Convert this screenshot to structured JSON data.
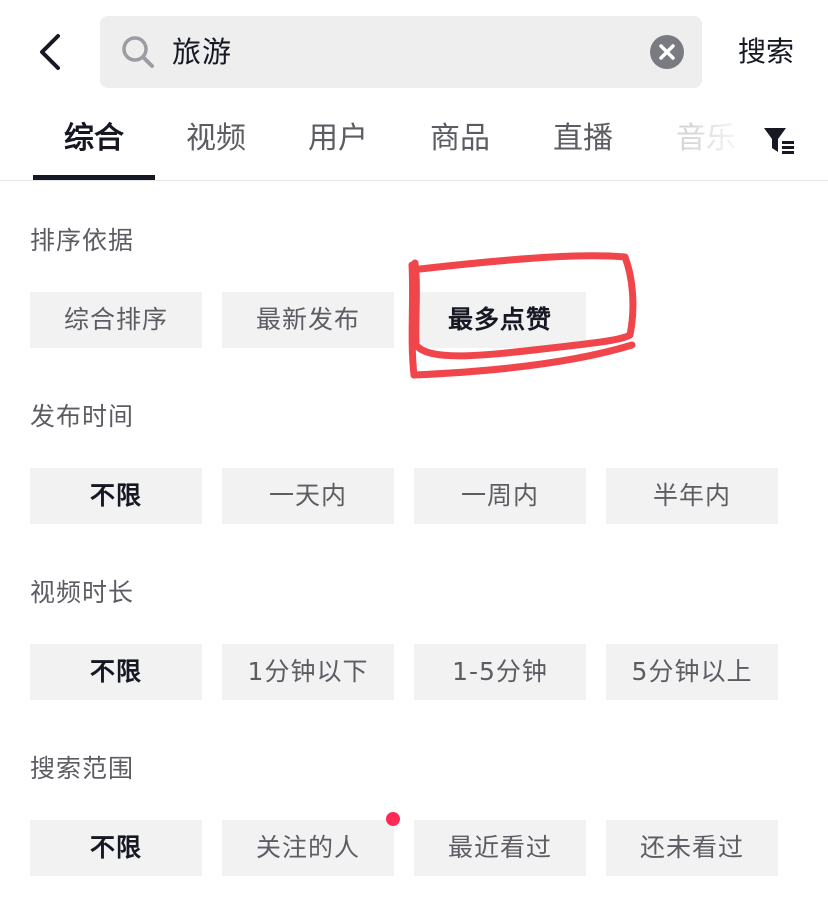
{
  "search": {
    "query": "旅游",
    "submit_label": "搜索"
  },
  "tabs": [
    {
      "label": "综合",
      "active": true
    },
    {
      "label": "视频"
    },
    {
      "label": "用户"
    },
    {
      "label": "商品"
    },
    {
      "label": "直播"
    },
    {
      "label": "音乐"
    }
  ],
  "filters": {
    "sort": {
      "title": "排序依据",
      "options": [
        "综合排序",
        "最新发布",
        "最多点赞"
      ],
      "selected": "最多点赞"
    },
    "publish_time": {
      "title": "发布时间",
      "options": [
        "不限",
        "一天内",
        "一周内",
        "半年内"
      ],
      "selected": "不限"
    },
    "duration": {
      "title": "视频时长",
      "options": [
        "不限",
        "1分钟以下",
        "1-5分钟",
        "5分钟以上"
      ],
      "selected": "不限"
    },
    "scope": {
      "title": "搜索范围",
      "options": [
        "不限",
        "关注的人",
        "最近看过",
        "还未看过"
      ],
      "selected": "不限"
    }
  },
  "colors": {
    "accent": "#fe2c55",
    "annotation": "#f0464b"
  },
  "icons": [
    "back-arrow-icon",
    "search-icon",
    "clear-icon",
    "filter-icon"
  ]
}
